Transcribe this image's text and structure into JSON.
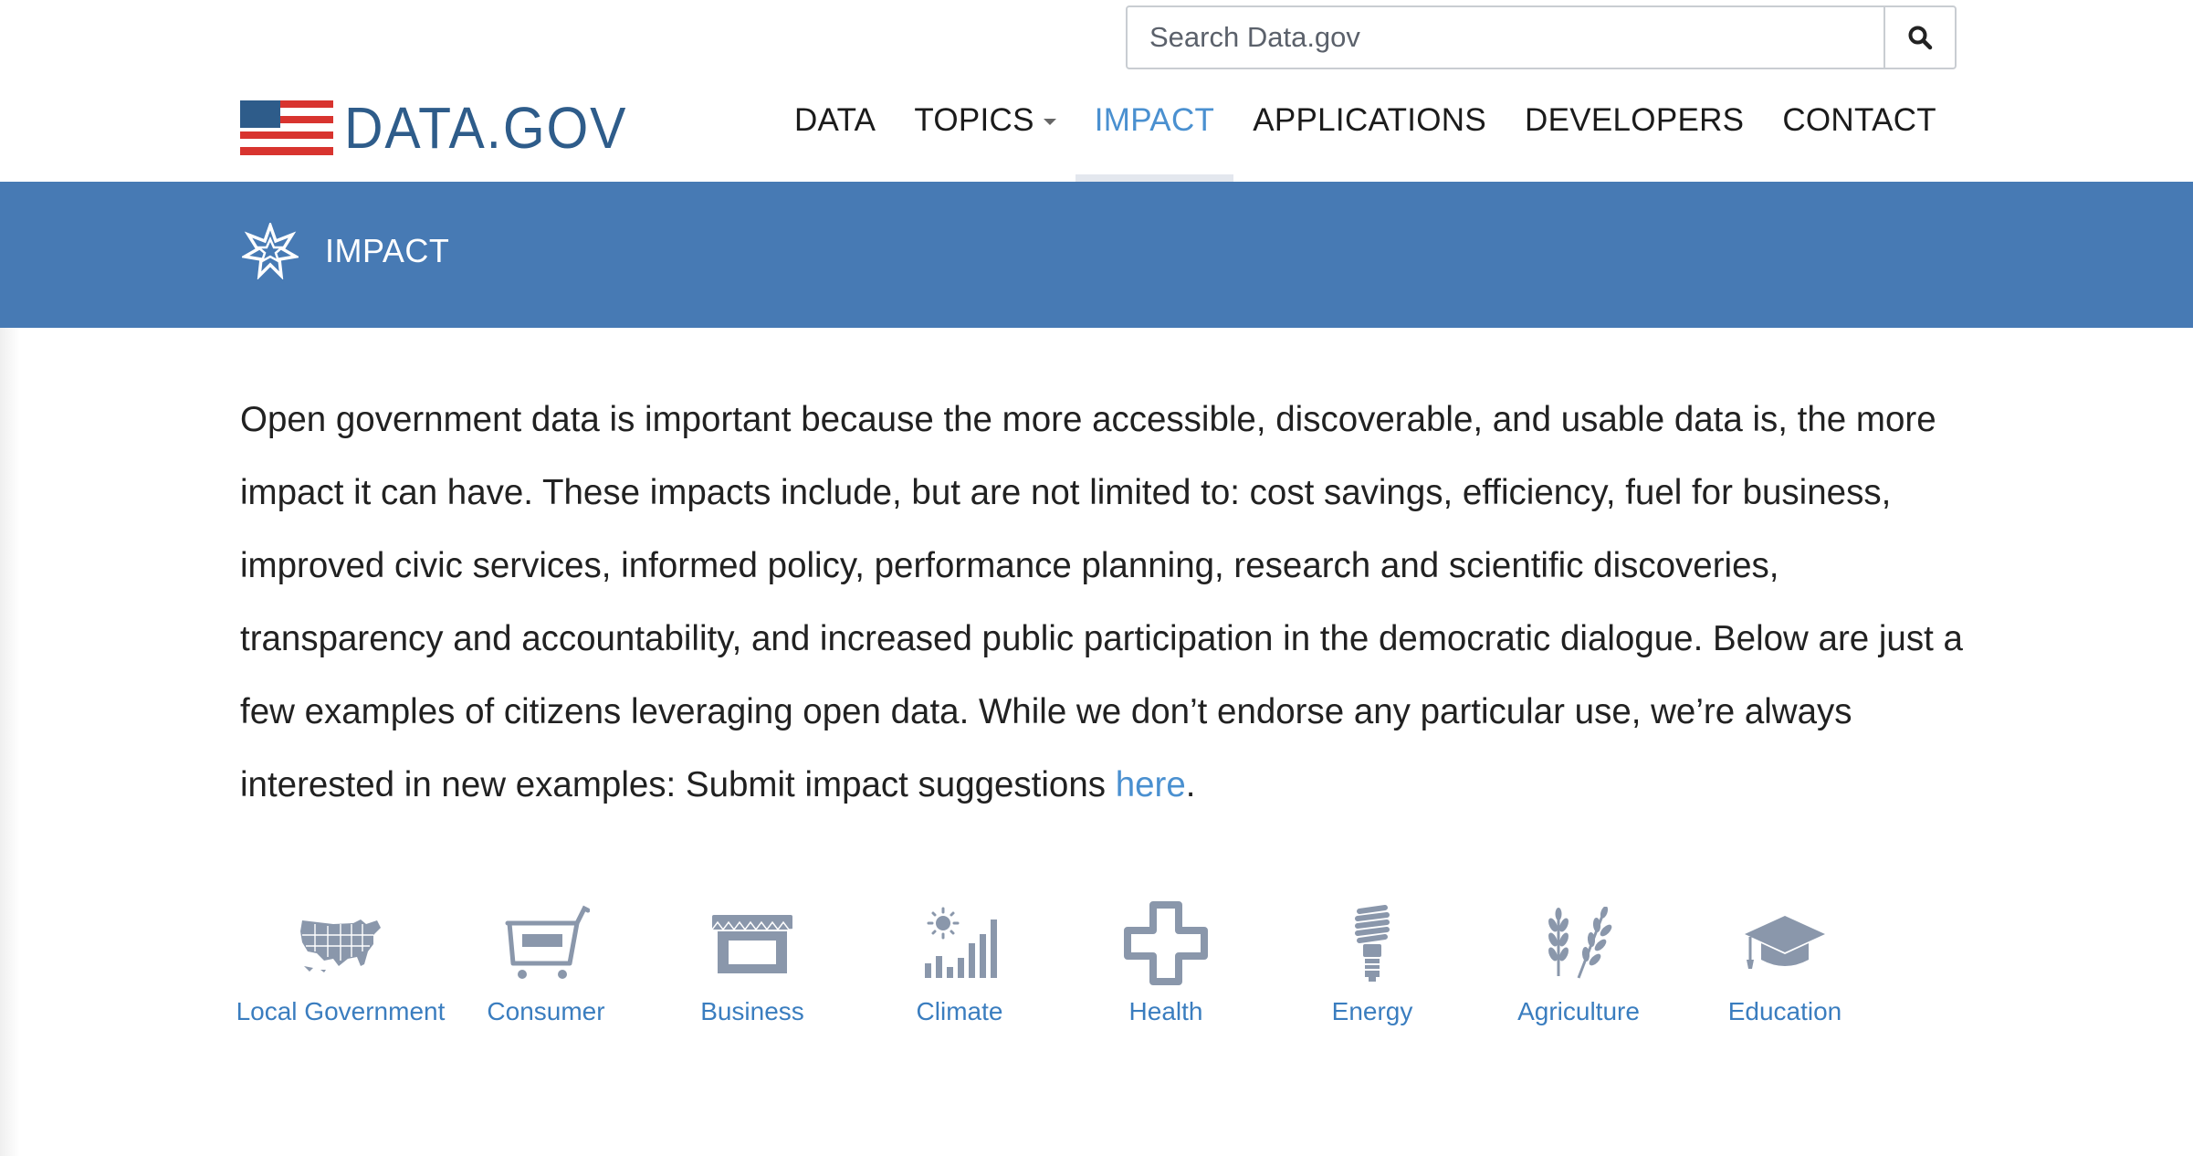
{
  "search": {
    "placeholder": "Search Data.gov"
  },
  "logo": {
    "text": "DATA.GOV"
  },
  "nav": {
    "items": [
      {
        "label": "DATA"
      },
      {
        "label": "TOPICS"
      },
      {
        "label": "IMPACT"
      },
      {
        "label": "APPLICATIONS"
      },
      {
        "label": "DEVELOPERS"
      },
      {
        "label": "CONTACT"
      }
    ]
  },
  "banner": {
    "title": "IMPACT"
  },
  "intro": {
    "text": "Open government data is important because the more accessible, discoverable, and usable data is, the more impact it can have. These impacts include, but are not limited to: cost savings, efficiency, fuel for business, improved civic services, informed policy, performance planning, research and scientific discoveries, transparency and accountability, and increased public participation in the democratic dialogue. Below are just a few examples of citizens leveraging open data. While we don’t endorse any particular use, we’re always interested in new examples: Submit impact suggestions ",
    "link_text": "here",
    "end": "."
  },
  "categories": [
    {
      "label": "Local Government",
      "icon": "us-map-icon"
    },
    {
      "label": "Consumer",
      "icon": "shopping-cart-icon"
    },
    {
      "label": "Business",
      "icon": "storefront-icon"
    },
    {
      "label": "Climate",
      "icon": "sun-bar-chart-icon"
    },
    {
      "label": "Health",
      "icon": "medical-cross-icon"
    },
    {
      "label": "Energy",
      "icon": "light-bulb-icon"
    },
    {
      "label": "Agriculture",
      "icon": "wheat-icon"
    },
    {
      "label": "Education",
      "icon": "graduation-cap-icon"
    }
  ],
  "colors": {
    "banner": "#477ab4",
    "link": "#4a90d0",
    "logo": "#2e5c8a",
    "icon": "#8a97ab",
    "flag_red": "#d8342f"
  }
}
